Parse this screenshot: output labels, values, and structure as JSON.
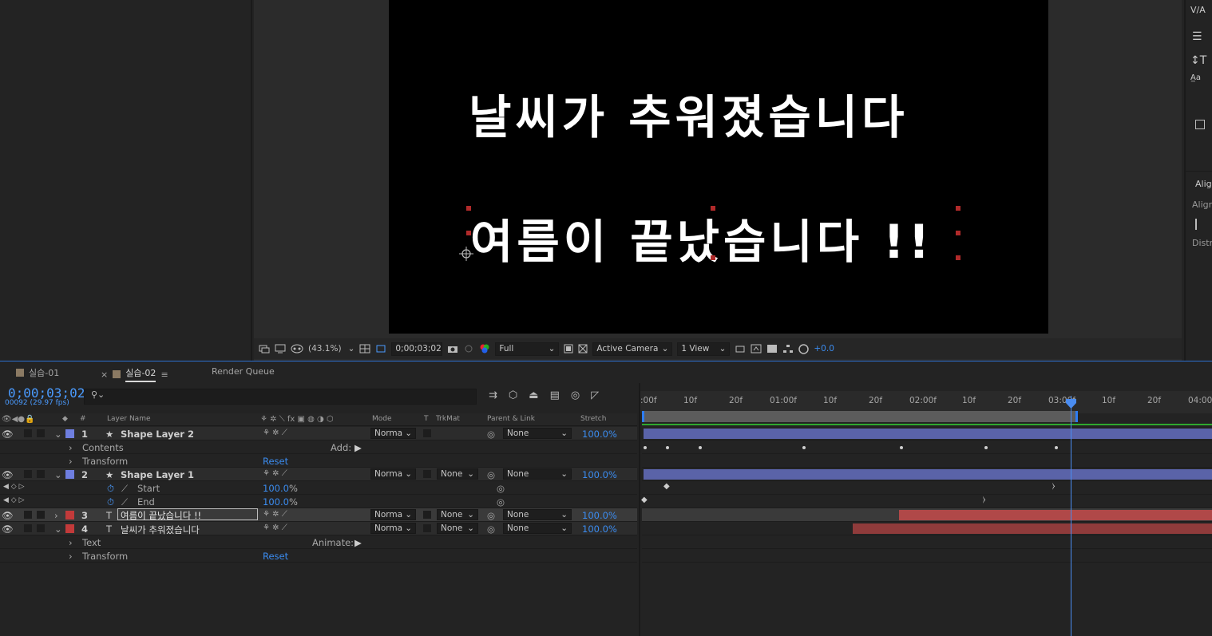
{
  "composition": {
    "line1": "날씨가 추워졌습니다",
    "line2": "여름이 끝났습니다 !!"
  },
  "viewer_toolbar": {
    "zoom": "(43.1%)",
    "timecode": "0;00;03;02",
    "resolution": "Full",
    "camera": "Active Camera",
    "views": "1 View",
    "exposure": "+0.0"
  },
  "tabs": [
    {
      "label": "실습-01"
    },
    {
      "label": "실습-02",
      "close": "×"
    },
    {
      "label": "Render Queue"
    }
  ],
  "timeline": {
    "timecode": "0;00;03;02",
    "frame_info": "00092 (29.97 fps)",
    "search_placeholder": "",
    "columns": {
      "num": "#",
      "layer_name": "Layer Name",
      "mode": "Mode",
      "t": "T",
      "trkmat": "TrkMat",
      "parent": "Parent & Link",
      "stretch": "Stretch"
    },
    "ruler_ticks": [
      ":00f",
      "10f",
      "20f",
      "01:00f",
      "10f",
      "20f",
      "02:00f",
      "10f",
      "20f",
      "03:00f",
      "10f",
      "20f",
      "04:00f"
    ],
    "layers": [
      {
        "num": "1",
        "type": "★",
        "name": "Shape Layer 2",
        "mode": "Norma",
        "trkmat": "",
        "parent": "None",
        "stretch": "100.0%",
        "color": "#6f7fe0"
      },
      {
        "num": "2",
        "type": "★",
        "name": "Shape Layer 1",
        "mode": "Norma",
        "trkmat": "None",
        "parent": "None",
        "stretch": "100.0%",
        "color": "#6f7fe0"
      },
      {
        "num": "3",
        "type": "T",
        "name": "여름이 끝났습니다 !!",
        "mode": "Norma",
        "trkmat": "None",
        "parent": "None",
        "stretch": "100.0%",
        "color": "#c23a3a"
      },
      {
        "num": "4",
        "type": "T",
        "name": "날씨가 추워졌습니다",
        "mode": "Norma",
        "trkmat": "None",
        "parent": "None",
        "stretch": "100.0%",
        "color": "#c23a3a"
      }
    ],
    "props": {
      "contents": "Contents",
      "add": "Add:",
      "transform": "Transform",
      "reset": "Reset",
      "start": "Start",
      "start_val": "100.0",
      "end": "End",
      "end_val": "100.0",
      "pct": "%",
      "text": "Text",
      "animate": "Animate:"
    }
  },
  "right_panel": {
    "align": "Alig",
    "align_sub": "Align",
    "distrib": "Distri"
  }
}
